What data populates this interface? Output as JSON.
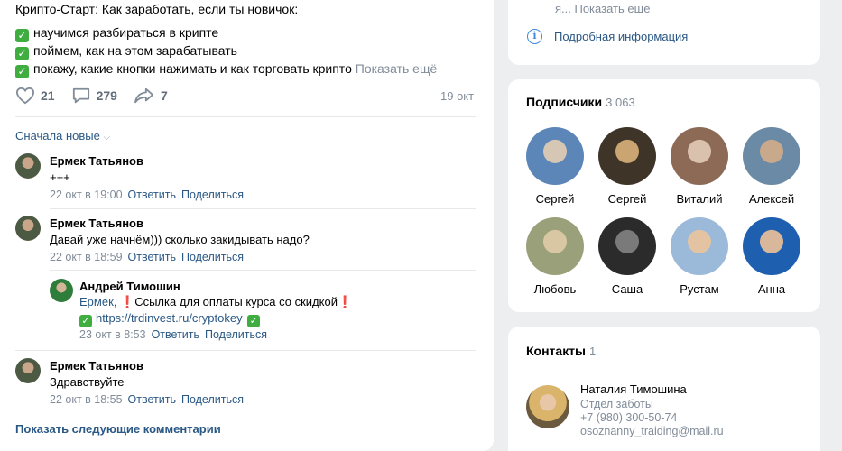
{
  "post": {
    "intro": "Крипто-Старт: Как заработать, если ты новичок:",
    "bullets": [
      "научимся разбираться в крипте",
      "поймем, как на этом зарабатывать",
      "покажу, какие кнопки нажимать и как торговать крипто"
    ],
    "show_more": "Показать ещё",
    "likes": "21",
    "comments": "279",
    "shares": "7",
    "date": "19 окт"
  },
  "comments": {
    "sort_label": "Сначала новые",
    "reply_label": "Ответить",
    "share_label": "Поделиться",
    "items": [
      {
        "author": "Ермек Татьянов",
        "text": "+++",
        "date": "22 окт в 19:00"
      },
      {
        "author": "Ермек Татьянов",
        "text": "Давай уже начнём))) сколько закидывать надо?",
        "date": "22 окт в 18:59"
      },
      {
        "author": "Андрей Тимошин",
        "mention": "Ермек,",
        "text": "Ссылка для оплаты курса со скидкой",
        "link": "https://trdinvest.ru/cryptokey",
        "date": "23 окт в 8:53"
      },
      {
        "author": "Ермек Татьянов",
        "text": "Здравствуйте",
        "date": "22 окт в 18:55"
      }
    ],
    "next_label": "Показать следующие комментарии"
  },
  "info": {
    "truncated_text": "я... Показать ещё",
    "details_label": "Подробная информация"
  },
  "subscribers": {
    "title": "Подписчики",
    "count": "3 063",
    "items": [
      {
        "name": "Сергей",
        "colors": [
          "#5c86b8",
          "#d6c6b4"
        ]
      },
      {
        "name": "Сергей",
        "colors": [
          "#3e3428",
          "#caa471"
        ]
      },
      {
        "name": "Виталий",
        "colors": [
          "#8c6a55",
          "#d9c1ad"
        ]
      },
      {
        "name": "Алексей",
        "colors": [
          "#6a8aa6",
          "#c9a98c"
        ]
      },
      {
        "name": "Любовь",
        "colors": [
          "#9aa17a",
          "#d8c7a2"
        ]
      },
      {
        "name": "Саша",
        "colors": [
          "#2b2b2b",
          "#7a7a7a"
        ]
      },
      {
        "name": "Рустам",
        "colors": [
          "#9bb9d9",
          "#e4c3a2"
        ]
      },
      {
        "name": "Анна",
        "colors": [
          "#1f5fb0",
          "#d8b79a"
        ]
      }
    ]
  },
  "contacts": {
    "title": "Контакты",
    "count": "1",
    "name": "Наталия Тимошина",
    "role": "Отдел заботы",
    "phone": "+7 (980) 300-50-74",
    "email": "osoznanny_traiding@mail.ru"
  },
  "colors": {
    "link": "#2a5885",
    "muted": "#818c99",
    "accent": "#3f8ae0",
    "check": "#3fad40"
  }
}
